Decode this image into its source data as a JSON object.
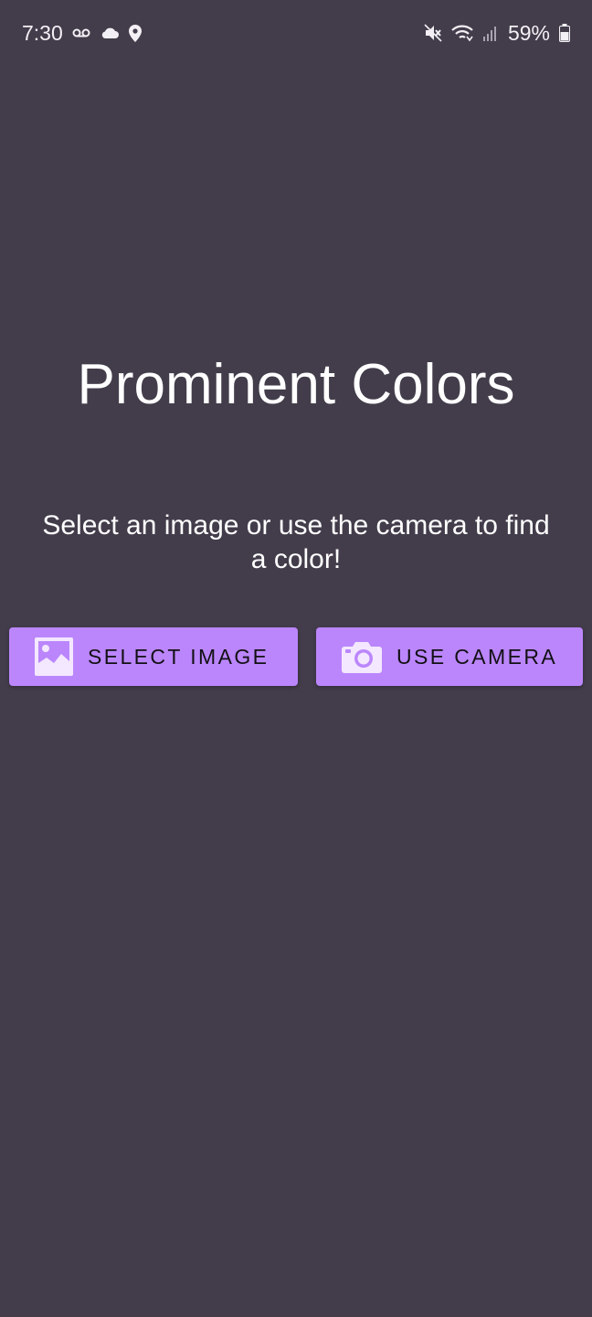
{
  "status_bar": {
    "time": "7:30",
    "battery_percent": "59%",
    "icons_left": [
      "voicemail-icon",
      "cloud-icon",
      "location-pin-icon"
    ],
    "icons_right": [
      "mute-icon",
      "wifi-icon",
      "signal-icon",
      "battery-icon"
    ]
  },
  "main": {
    "title": "Prominent Colors",
    "subtitle": "Select an image or use the camera to find a color!"
  },
  "buttons": {
    "select_image": {
      "label": "SELECT IMAGE",
      "icon": "image-icon"
    },
    "use_camera": {
      "label": "USE CAMERA",
      "icon": "camera-icon"
    }
  },
  "colors": {
    "background": "#433d4b",
    "button": "#bb86fc",
    "button_text": "#121014",
    "text": "#ffffff"
  }
}
